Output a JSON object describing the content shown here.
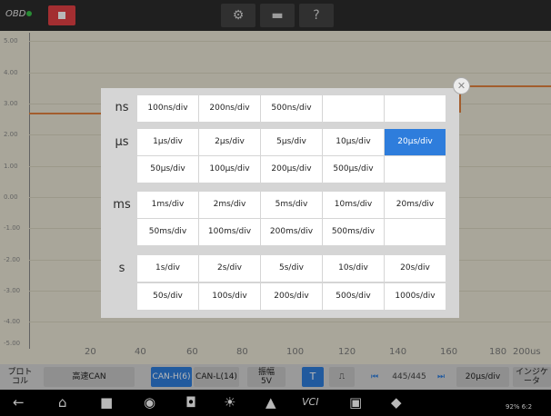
{
  "toolbar": {
    "obd_label": "OBD",
    "icons": [
      "stop-icon",
      "gear-icon",
      "folder-icon",
      "help-icon"
    ],
    "stop_color": "#e24045"
  },
  "scope": {
    "y_ticks": [
      "5.00",
      "4.00",
      "3.00",
      "2.00",
      "1.00",
      "0.00",
      "-1.00",
      "-2.00",
      "-3.00",
      "-4.00",
      "-5.00"
    ],
    "x_ticks": [
      "20",
      "40",
      "60",
      "80",
      "100",
      "120",
      "140",
      "160",
      "180",
      "200us"
    ],
    "trace_color": "#e2823f"
  },
  "controls": {
    "protocol": "プロト\nコル",
    "can_mode": "高速CAN",
    "can_h": "CAN-H(6)",
    "can_l": "CAN-L(14)",
    "amplitude": "振幅\n5V",
    "trigger": "T",
    "edge": "⎍",
    "frame": "445/445",
    "timebase": "20μs/div",
    "indicator": "インジケ\nータ"
  },
  "dialog": {
    "units": [
      "ns",
      "μs",
      "ms",
      "s"
    ],
    "rows": [
      [
        "100ns/div",
        "200ns/div",
        "500ns/div",
        "",
        ""
      ],
      [
        "1μs/div",
        "2μs/div",
        "5μs/div",
        "10μs/div",
        "20μs/div"
      ],
      [
        "50μs/div",
        "100μs/div",
        "200μs/div",
        "500μs/div",
        ""
      ],
      [
        "1ms/div",
        "2ms/div",
        "5ms/div",
        "10ms/div",
        "20ms/div"
      ],
      [
        "50ms/div",
        "100ms/div",
        "200ms/div",
        "500ms/div",
        ""
      ],
      [
        "1s/div",
        "2s/div",
        "5s/div",
        "10s/div",
        "20s/div"
      ],
      [
        "50s/div",
        "100s/div",
        "200s/div",
        "500s/div",
        "1000s/div"
      ]
    ],
    "selected": "20μs/div",
    "accent": "#2e7ddc"
  },
  "status": {
    "battery": "92%",
    "time": "6:2"
  }
}
